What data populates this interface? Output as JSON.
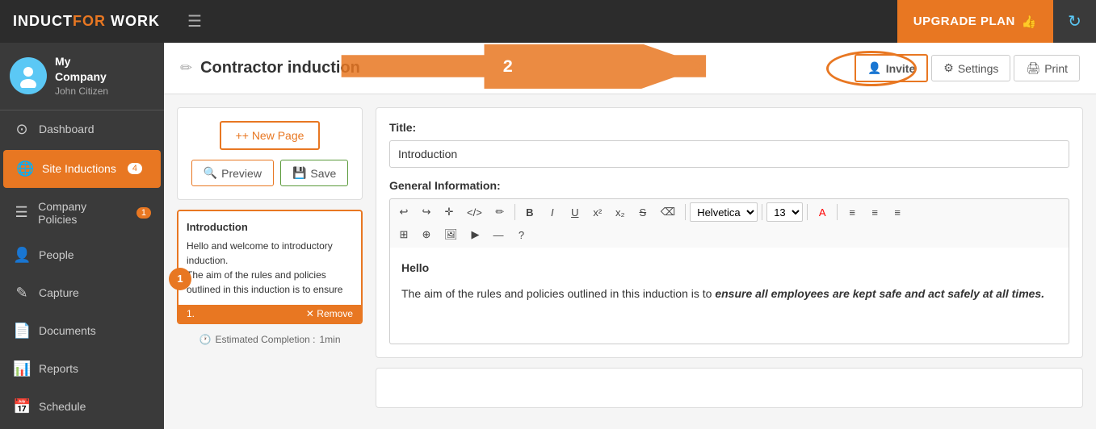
{
  "topbar": {
    "logo_induct": "INDUCT",
    "logo_for": "FOR",
    "logo_work": "WORK",
    "upgrade_label": "UPGRADE PLAN",
    "upgrade_icon": "👍"
  },
  "sidebar": {
    "profile": {
      "company": "My Company",
      "name": "John Citizen"
    },
    "items": [
      {
        "id": "dashboard",
        "label": "Dashboard",
        "icon": "⊙",
        "badge": null,
        "active": false
      },
      {
        "id": "site-inductions",
        "label": "Site Inductions",
        "icon": "🌐",
        "badge": "(4)",
        "active": true
      },
      {
        "id": "company-policies",
        "label": "Company Policies",
        "icon": "☰",
        "badge": "(1)",
        "active": false
      },
      {
        "id": "people",
        "label": "People",
        "icon": "👤",
        "badge": null,
        "active": false
      },
      {
        "id": "capture",
        "label": "Capture",
        "icon": "✎",
        "badge": null,
        "active": false
      },
      {
        "id": "documents",
        "label": "Documents",
        "icon": "📄",
        "badge": null,
        "active": false
      },
      {
        "id": "reports",
        "label": "Reports",
        "icon": "📊",
        "badge": null,
        "active": false
      },
      {
        "id": "schedule",
        "label": "Schedule",
        "icon": "📅",
        "badge": null,
        "active": false
      }
    ]
  },
  "content_header": {
    "title": "Contractor induction",
    "invite_label": "Invite",
    "settings_label": "Settings",
    "print_label": "Print"
  },
  "left_panel": {
    "new_page_label": "+ New Page",
    "preview_label": "Preview",
    "save_label": "Save",
    "page_item": {
      "title": "Introduction",
      "text1": "Hello and welcome to introductory induction.",
      "text2": "The aim of the rules and policies outlined in this induction is to ensure",
      "number": "1.",
      "remove_label": "✕ Remove"
    },
    "estimated_label": "Estimated Completion :",
    "estimated_value": "1min"
  },
  "editor": {
    "title_label": "Title:",
    "title_value": "Introduction",
    "general_info_label": "General Information:",
    "toolbar": {
      "row1": [
        "↩",
        "↪",
        "✛",
        "</>",
        "✏",
        "B",
        "I",
        "U",
        "x²",
        "x₂",
        "S",
        "⌫",
        "Helvetica",
        "13",
        "A",
        "≡",
        "≡",
        "≡"
      ],
      "row2": [
        "⊞",
        "⊕",
        "🖼",
        "▶",
        "—",
        "?"
      ]
    },
    "editor_hello": "Hello",
    "editor_body": "The aim of the rules and policies outlined in this induction is to ensure all employees are kept safe and act safely at all times."
  },
  "annotation": {
    "arrow_number": "2",
    "step_number": "1"
  }
}
